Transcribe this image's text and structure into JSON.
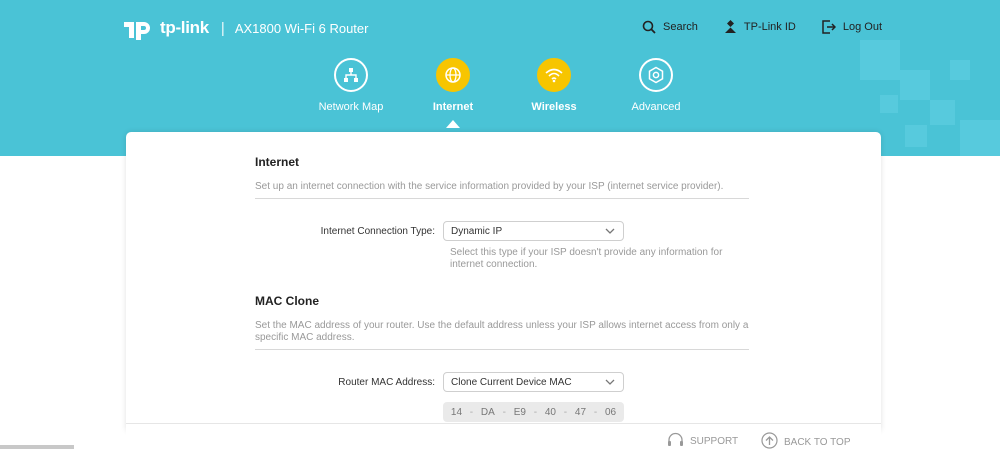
{
  "header": {
    "brand": "tp-link",
    "separator": "|",
    "model": "AX1800 Wi-Fi 6 Router",
    "links": [
      {
        "label": "Search",
        "icon": "search-icon"
      },
      {
        "label": "TP-Link ID",
        "icon": "tplink-id-icon"
      },
      {
        "label": "Log Out",
        "icon": "logout-icon"
      }
    ],
    "nav": [
      {
        "label": "Network Map",
        "icon": "network-map-icon",
        "active": false
      },
      {
        "label": "Internet",
        "icon": "globe-icon",
        "active": true
      },
      {
        "label": "Wireless",
        "icon": "wifi-icon",
        "active": false
      },
      {
        "label": "Advanced",
        "icon": "gear-icon",
        "active": false
      }
    ]
  },
  "internet": {
    "title": "Internet",
    "description": "Set up an internet connection with the service information provided by your ISP (internet service provider).",
    "connection_type_label": "Internet Connection Type:",
    "connection_type_value": "Dynamic IP",
    "connection_type_hint": "Select this type if your ISP doesn't provide any information for internet connection."
  },
  "mac_clone": {
    "title": "MAC Clone",
    "description": "Set the MAC address of your router. Use the default address unless your ISP allows internet access from only a specific MAC address.",
    "router_mac_label": "Router MAC Address:",
    "router_mac_value": "Clone Current Device MAC",
    "mac_octets": [
      "14",
      "DA",
      "E9",
      "40",
      "47",
      "06"
    ],
    "mac_separator": "-"
  },
  "footer": {
    "support_label": "SUPPORT",
    "back_to_top_label": "BACK TO TOP"
  },
  "colors": {
    "header_bg": "#4ac3d6",
    "accent": "#f7c500"
  }
}
